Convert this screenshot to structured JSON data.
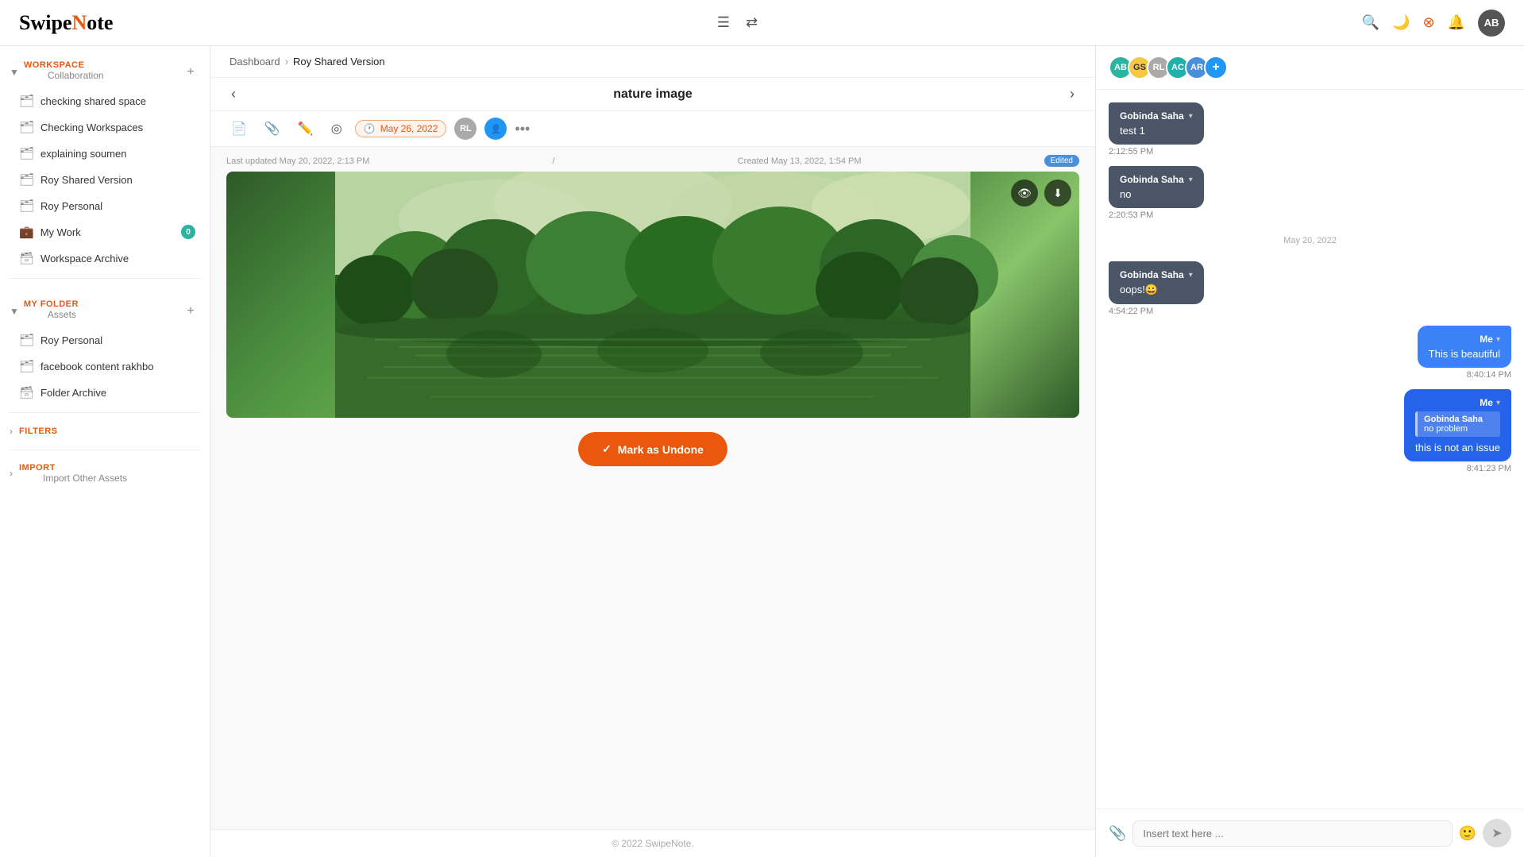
{
  "app": {
    "logo_text": "SwipeNote",
    "logo_dot": "●",
    "copyright": "© 2022 SwipeNote."
  },
  "navbar": {
    "search_icon": "🔍",
    "moon_icon": "🌙",
    "fire_icon": "🔴",
    "bell_icon": "🔔",
    "user_initials": "AB"
  },
  "sidebar": {
    "workspace_label": "WORKSPACE",
    "workspace_sub": "Collaboration",
    "workspace_items": [
      {
        "label": "checking shared space",
        "type": "folder"
      },
      {
        "label": "Checking Workspaces",
        "type": "folder"
      },
      {
        "label": "explaining soumen",
        "type": "folder"
      },
      {
        "label": "Roy Shared Version",
        "type": "folder"
      },
      {
        "label": "Roy Personal",
        "type": "folder"
      }
    ],
    "my_work_label": "My Work",
    "my_work_badge": "0",
    "workspace_archive_label": "Workspace Archive",
    "myfolder_label": "MY FOLDER",
    "myfolder_sub": "Assets",
    "myfolder_items": [
      {
        "label": "Roy Personal",
        "type": "folder"
      },
      {
        "label": "facebook content rakhbo",
        "type": "folder"
      }
    ],
    "folder_archive_label": "Folder Archive",
    "filters_label": "FILTERS",
    "import_label": "IMPORT",
    "import_sub": "Import Other Assets"
  },
  "breadcrumb": {
    "home": "Dashboard",
    "sep": "›",
    "current": "Roy Shared Version"
  },
  "note": {
    "title": "nature image",
    "last_updated": "Last updated May 20, 2022, 2:13 PM",
    "separator": "/",
    "created": "Created May 13, 2022, 1:54 PM",
    "edited_badge": "Edited",
    "toolbar_date": "May 26, 2022",
    "toolbar_user1": "RL",
    "mark_undone_label": "Mark as Undone"
  },
  "chat": {
    "avatars": [
      {
        "initials": "AB",
        "color": "av-green"
      },
      {
        "initials": "GS",
        "color": "av-yellow"
      },
      {
        "initials": "RL",
        "color": "av-gray"
      },
      {
        "initials": "AC",
        "color": "av-teal"
      },
      {
        "initials": "AR",
        "color": "av-blue"
      }
    ],
    "messages": [
      {
        "side": "left",
        "sender": "Gobinda Saha",
        "text": "test 1",
        "time": "2:12:55 PM"
      },
      {
        "side": "left",
        "sender": "Gobinda Saha",
        "text": "no",
        "time": "2:20:53 PM"
      },
      {
        "date_divider": "May 20, 2022"
      },
      {
        "side": "left",
        "sender": "Gobinda Saha",
        "text": "oops!😀",
        "time": "4:54:22 PM"
      },
      {
        "side": "right",
        "sender": "Me",
        "text": "This is beautiful",
        "time": "8:40:14 PM"
      },
      {
        "side": "right",
        "sender": "Me",
        "reply_preview_sender": "Gobinda Saha",
        "reply_preview_text": "no problem",
        "text": "this is not an issue",
        "time": "8:41:23 PM"
      }
    ],
    "input_placeholder": "Insert text here ..."
  }
}
